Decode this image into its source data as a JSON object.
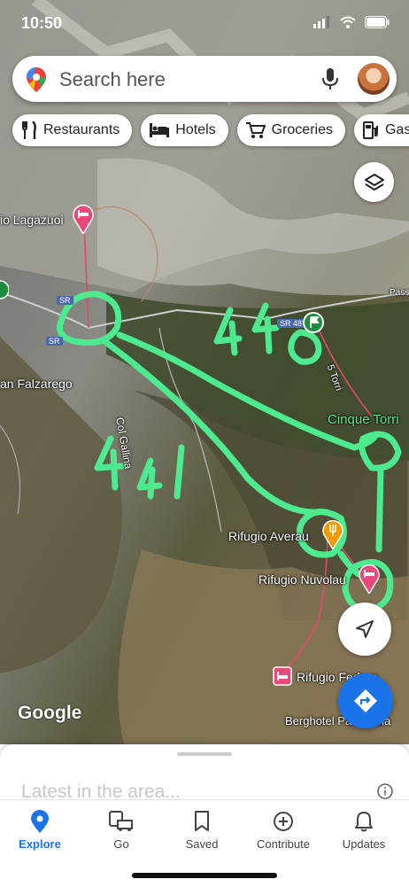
{
  "status": {
    "time": "10:50"
  },
  "search": {
    "placeholder": "Search here"
  },
  "chips": [
    {
      "label": "Restaurants",
      "icon": "fork-knife-icon"
    },
    {
      "label": "Hotels",
      "icon": "bed-icon"
    },
    {
      "label": "Groceries",
      "icon": "cart-icon"
    },
    {
      "label": "Gas",
      "icon": "fuel-icon"
    }
  ],
  "map_labels": {
    "lagazuoi": "io Lagazuoi",
    "falzarego": "an Falzarego",
    "col_gallina": "Col Gallina",
    "cinque_torri": "Cinque Torri",
    "five_torri": "5 Torri",
    "averau": "Rifugio Averau",
    "nuvolau": "Rifugio Nuvolau",
    "fedare": "Rifugio Fedare",
    "berghotel": "Berghotel Passo Gia",
    "sr_a": "SR",
    "sr_b": "SR",
    "sr_c": "SR 48",
    "pass": "Pass",
    "annotation_440": "440",
    "annotation_441": "441"
  },
  "brand": "Google",
  "sheet": {
    "title": "Latest in the area..."
  },
  "nav": [
    {
      "label": "Explore",
      "active": true
    },
    {
      "label": "Go",
      "active": false
    },
    {
      "label": "Saved",
      "active": false
    },
    {
      "label": "Contribute",
      "active": false
    },
    {
      "label": "Updates",
      "active": false
    }
  ],
  "colors": {
    "accent": "#1a73e8",
    "annotation": "#4eea8f",
    "hotel_pin": "#e8487a",
    "food_pin": "#f29900"
  }
}
